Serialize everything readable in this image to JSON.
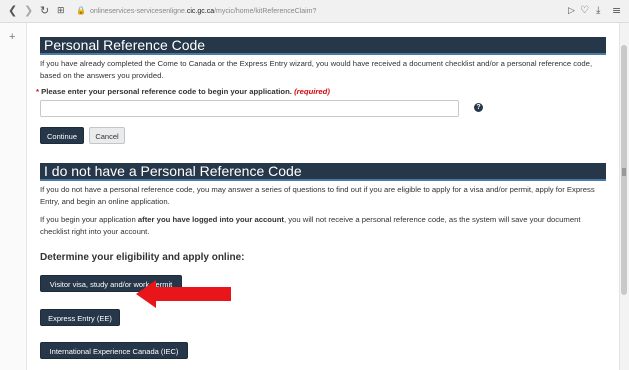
{
  "browser": {
    "url_prefix": "onlineservices-servicesenligne.",
    "url_domain": "cic.gc.ca",
    "url_suffix": "/mycic/home/kitReferenceClaim?",
    "back_icon": "chevron-left-icon",
    "forward_icon": "chevron-right-icon",
    "reload_icon": "reload-icon",
    "apps_icon": "apps-grid-icon",
    "lock_icon": "lock-icon"
  },
  "section1": {
    "title": "Personal Reference Code",
    "description": "If you have already completed the Come to Canada or the Express Entry wizard, you would have received a document checklist and/or a personal reference code, based on the answers you provided.",
    "field_label": "Please enter your personal reference code to begin your application.",
    "required_text": "(required)",
    "input_value": "",
    "help_icon": "?",
    "continue_label": "Continue",
    "cancel_label": "Cancel"
  },
  "section2": {
    "title": "I do not have a Personal Reference Code",
    "para1": "If you do not have a personal reference code, you may answer a series of questions to find out if you are eligible to apply for a visa and/or permit, apply for Express Entry, and begin an online application.",
    "para2_pre": "If you begin your application ",
    "para2_bold": "after you have logged into your account",
    "para2_post": ", you will not receive a personal reference code, as the system will save your document checklist right into your account.",
    "subheading": "Determine your eligibility and apply online:",
    "buttons": [
      "Visitor visa, study and/or work permit",
      "Express Entry (EE)",
      "International Experience Canada (IEC)"
    ]
  },
  "annotation": {
    "arrow_color": "#e8151b"
  },
  "colors": {
    "primary": "#26374a",
    "required": "#d3080c"
  }
}
